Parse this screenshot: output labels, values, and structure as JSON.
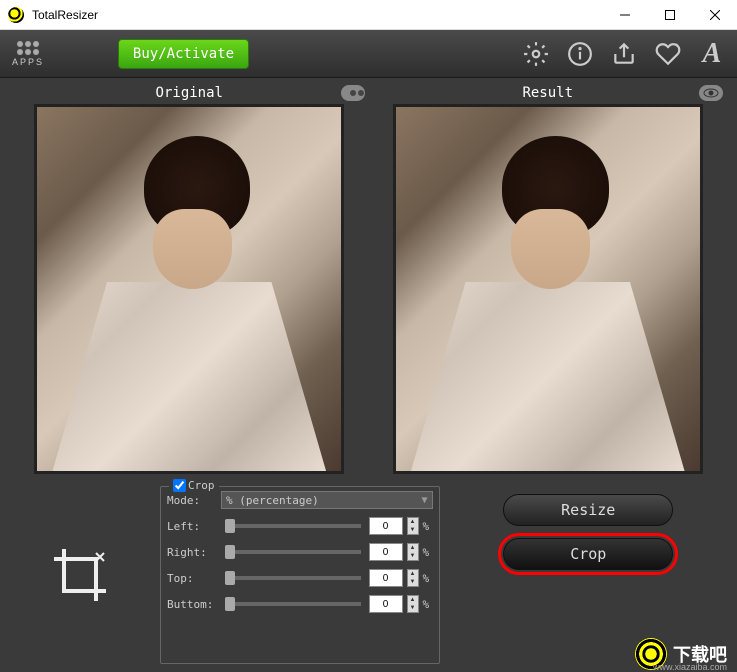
{
  "window": {
    "title": "TotalResizer"
  },
  "toolbar": {
    "apps_label": "APPS",
    "buy_label": "Buy/Activate"
  },
  "panels": {
    "original_label": "Original",
    "result_label": "Result"
  },
  "crop": {
    "legend": "Crop",
    "checked": true,
    "mode_label": "Mode:",
    "mode_value": "% (percentage)",
    "rows": [
      {
        "label": "Left:",
        "value": "0",
        "unit": "%"
      },
      {
        "label": "Right:",
        "value": "0",
        "unit": "%"
      },
      {
        "label": "Top:",
        "value": "0",
        "unit": "%"
      },
      {
        "label": "Buttom:",
        "value": "0",
        "unit": "%"
      }
    ]
  },
  "actions": {
    "resize_label": "Resize",
    "crop_label": "Crop"
  },
  "watermark": {
    "text": "下载吧",
    "url": "www.xiazaiba.com"
  }
}
